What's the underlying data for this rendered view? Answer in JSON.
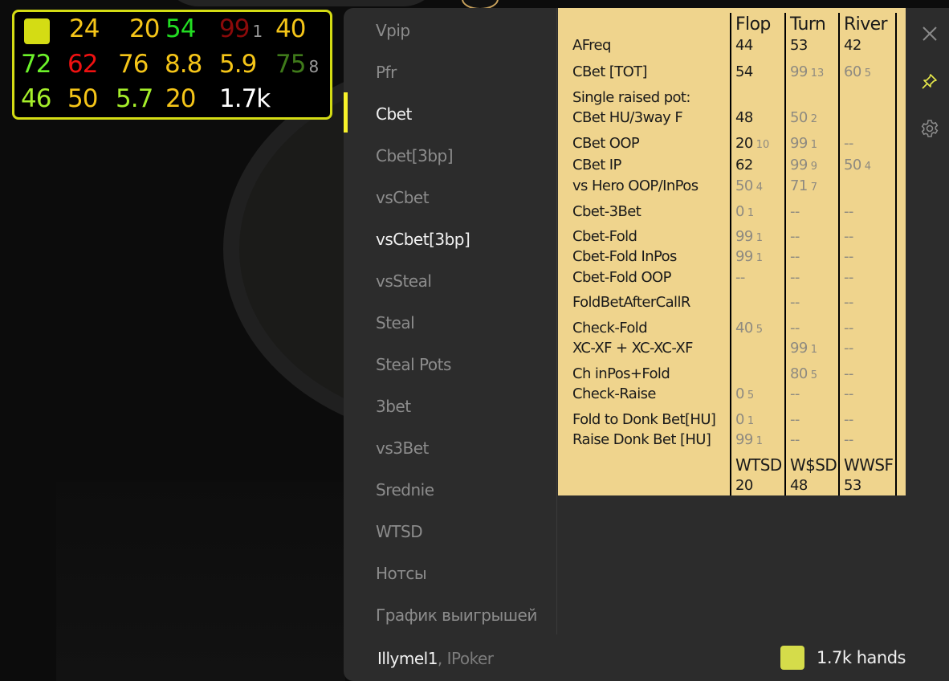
{
  "hud": {
    "color_badge": "#d4dc14",
    "rows": [
      [
        {
          "value": "24",
          "color": "#f5c518"
        },
        {
          "value": "20",
          "color": "#f5c518"
        },
        {
          "value": "54",
          "color": "#22dd22"
        },
        {
          "value": "99",
          "color": "#8b0a0a",
          "sub": "1"
        },
        {
          "value": "40",
          "color": "#f5c518"
        }
      ],
      [
        {
          "value": "72",
          "color": "#6cf22a"
        },
        {
          "value": "62",
          "color": "#ee1111"
        },
        {
          "value": "76",
          "color": "#f5c518"
        },
        {
          "value": "8.8",
          "color": "#f5c518"
        },
        {
          "value": "5.9",
          "color": "#f5c518"
        },
        {
          "value": "75",
          "color": "#3f7a1a",
          "sub": "8"
        }
      ],
      [
        {
          "value": "46",
          "color": "#a5ee2a"
        },
        {
          "value": "50",
          "color": "#f5c518"
        },
        {
          "value": "5.7",
          "color": "#a5ee2a"
        },
        {
          "value": "20",
          "color": "#f5c518"
        },
        {
          "value": "1.7k",
          "color": "#ffffff"
        }
      ]
    ]
  },
  "nav": {
    "items": [
      {
        "label": "Vpip"
      },
      {
        "label": "Pfr"
      },
      {
        "label": "Cbet",
        "active": true
      },
      {
        "label": "Cbet[3bp]"
      },
      {
        "label": "vsCbet"
      },
      {
        "label": "vsCbet[3bp]",
        "bright": true
      },
      {
        "label": "vsSteal"
      },
      {
        "label": "Steal"
      },
      {
        "label": "Steal Pots"
      },
      {
        "label": "3bet"
      },
      {
        "label": "vs3Bet"
      },
      {
        "label": "Srednie"
      },
      {
        "label": "WTSD"
      },
      {
        "label": "Нотсы"
      },
      {
        "label": "График выигрышей"
      }
    ]
  },
  "stats": {
    "columns": [
      "Flop",
      "Turn",
      "River"
    ],
    "rows": [
      {
        "label": "AFreq",
        "cells": [
          {
            "v": "44"
          },
          {
            "v": "53"
          },
          {
            "v": "42"
          }
        ]
      },
      {
        "label": "CBet [TOT]",
        "cells": [
          {
            "v": "54"
          },
          {
            "v": "99",
            "n": "13",
            "dim": true
          },
          {
            "v": "60",
            "n": "5",
            "dim": true
          }
        ]
      },
      {
        "label": "Single raised pot:",
        "cells": [
          null,
          null,
          null
        ]
      },
      {
        "label": "CBet HU/3way F",
        "cells": [
          {
            "v": "48"
          },
          {
            "v": "50",
            "n": "2",
            "dim": true
          },
          null
        ]
      },
      {
        "label": "CBet OOP",
        "cells": [
          {
            "v": "20",
            "n": "10"
          },
          {
            "v": "99",
            "n": "1",
            "dim": true
          },
          {
            "v": "--",
            "dim": true
          }
        ]
      },
      {
        "label": "CBet IP",
        "cells": [
          {
            "v": "62"
          },
          {
            "v": "99",
            "n": "9",
            "dim": true
          },
          {
            "v": "50",
            "n": "4",
            "dim": true
          }
        ]
      },
      {
        "label": "vs Hero OOP/InPos",
        "cells": [
          {
            "v": "50",
            "n": "4",
            "dim": true
          },
          {
            "v": "71",
            "n": "7",
            "dim": true
          },
          null
        ]
      },
      {
        "label": "Cbet-3Bet",
        "cells": [
          {
            "v": "0",
            "n": "1",
            "dim": true
          },
          {
            "v": "--",
            "dim": true
          },
          {
            "v": "--",
            "dim": true
          }
        ]
      },
      {
        "label": "Cbet-Fold",
        "cells": [
          {
            "v": "99",
            "n": "1",
            "dim": true
          },
          {
            "v": "--",
            "dim": true
          },
          {
            "v": "--",
            "dim": true
          }
        ]
      },
      {
        "label": "Cbet-Fold InPos",
        "cells": [
          {
            "v": "99",
            "n": "1",
            "dim": true
          },
          {
            "v": "--",
            "dim": true
          },
          {
            "v": "--",
            "dim": true
          }
        ]
      },
      {
        "label": "Cbet-Fold OOP",
        "cells": [
          {
            "v": "--",
            "dim": true
          },
          {
            "v": "--",
            "dim": true
          },
          {
            "v": "--",
            "dim": true
          }
        ]
      },
      {
        "label": "FoldBetAfterCallR",
        "cells": [
          null,
          {
            "v": "--",
            "dim": true
          },
          {
            "v": "--",
            "dim": true
          }
        ]
      },
      {
        "label": "Check-Fold",
        "cells": [
          {
            "v": "40",
            "n": "5",
            "dim": true
          },
          {
            "v": "--",
            "dim": true
          },
          {
            "v": "--",
            "dim": true
          }
        ]
      },
      {
        "label": "XC-XF + XC-XC-XF",
        "cells": [
          null,
          {
            "v": "99",
            "n": "1",
            "dim": true
          },
          {
            "v": "--",
            "dim": true
          }
        ]
      },
      {
        "label": "Ch inPos+Fold",
        "cells": [
          null,
          {
            "v": "80",
            "n": "5",
            "dim": true
          },
          {
            "v": "--",
            "dim": true
          }
        ]
      },
      {
        "label": "Check-Raise",
        "cells": [
          {
            "v": "0",
            "n": "5",
            "dim": true
          },
          {
            "v": "--",
            "dim": true
          },
          {
            "v": "--",
            "dim": true
          }
        ]
      },
      {
        "label": "Fold to Donk Bet[HU]",
        "cells": [
          {
            "v": "0",
            "n": "1",
            "dim": true
          },
          {
            "v": "--",
            "dim": true
          },
          {
            "v": "--",
            "dim": true
          }
        ]
      },
      {
        "label": "Raise Donk Bet [HU]",
        "cells": [
          {
            "v": "99",
            "n": "1",
            "dim": true
          },
          {
            "v": "--",
            "dim": true
          },
          {
            "v": "--",
            "dim": true
          }
        ]
      }
    ],
    "footer": {
      "headers": [
        "WTSD",
        "W$SD",
        "WWSF"
      ],
      "values": [
        "20",
        "48",
        "53"
      ]
    }
  },
  "player": {
    "name": "Illymel1",
    "separator": ", ",
    "site": "IPoker"
  },
  "hands": {
    "label": "1.7k hands",
    "color": "#d5dc4a"
  },
  "toolbar": {
    "close": "close-icon",
    "pin": "pin-icon",
    "settings": "gear-icon",
    "pin_color": "#e6e84a"
  }
}
